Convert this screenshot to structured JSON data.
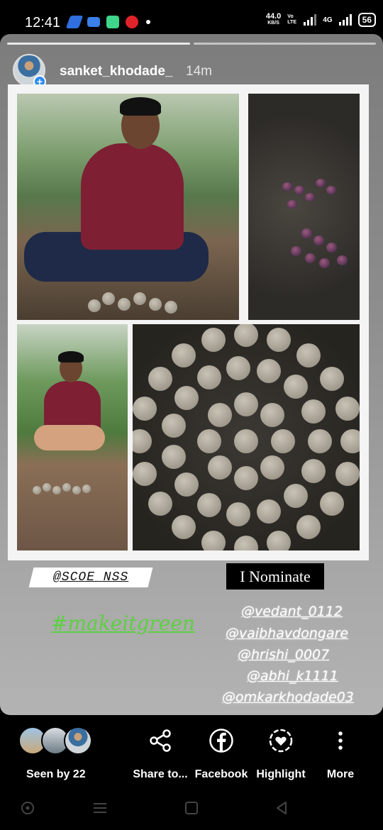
{
  "status_bar": {
    "time": "12:41",
    "speed_value": "44.0",
    "speed_unit": "KB/S",
    "volte": "Vo LTE",
    "network": "4G",
    "battery": "56",
    "notif_icons": [
      "pay-icon",
      "mail-icon",
      "app-icon",
      "airtel-icon"
    ]
  },
  "story": {
    "username": "sanket_khodade_",
    "time_ago": "14m",
    "progress_segments": 2,
    "stickers": {
      "mention": "@SCOE_NSS",
      "nominate": "I Nominate",
      "hashtag": "#makeitgreen",
      "nominees": [
        "@vedant_0112",
        "@vaibhavdongare",
        "@hrishi_0007",
        "@abhi_k1111",
        "@omkarkhodade03"
      ]
    }
  },
  "bottom_bar": {
    "seen_label": "Seen by 22",
    "actions": [
      {
        "label": "Share to...",
        "icon": "share-icon"
      },
      {
        "label": "Facebook",
        "icon": "facebook-icon"
      },
      {
        "label": "Highlight",
        "icon": "highlight-icon"
      },
      {
        "label": "More",
        "icon": "more-icon"
      }
    ]
  },
  "colors": {
    "hashtag": "#5bd13f",
    "badge": "#2d8cf0",
    "background": "#000000"
  }
}
